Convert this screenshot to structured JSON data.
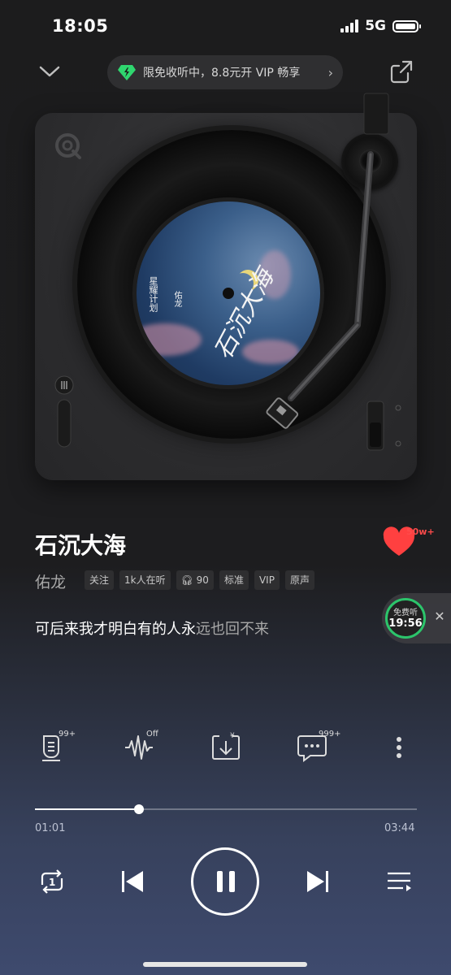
{
  "status": {
    "time": "18:05",
    "network": "5G"
  },
  "promo": {
    "text": "限免收听中，8.8元开 VIP 畅享"
  },
  "album": {
    "art_artist": "佑龙",
    "art_title": "石沉大海",
    "art_series": "星耀计划"
  },
  "song": {
    "title": "石沉大海",
    "artist": "佑龙",
    "like_count": "50w+"
  },
  "tags": [
    "关注",
    "1k人在听",
    "90",
    "标准",
    "VIP",
    "原声"
  ],
  "lyric": {
    "sung": "可后来我才明白有的人永",
    "unsung": "远也回不来"
  },
  "free_listen": {
    "label": "免费听",
    "time": "19:56"
  },
  "actions": {
    "lyrics_badge": "99+",
    "effect_badge": "Off",
    "comments_badge": "999+"
  },
  "progress": {
    "current": "01:01",
    "total": "03:44",
    "fraction": 0.273
  },
  "colors": {
    "like": "#ff4040",
    "free_ring": "#2cc56b",
    "promo_icon": "#2fd66f"
  }
}
